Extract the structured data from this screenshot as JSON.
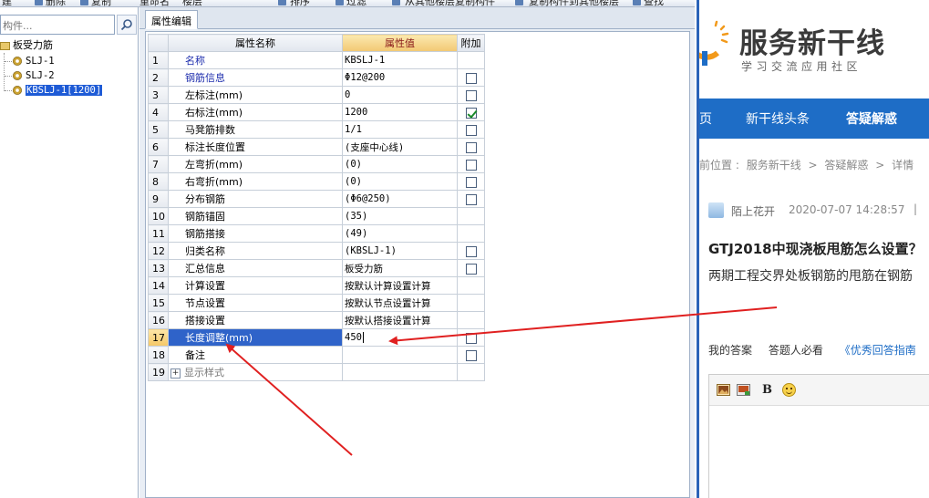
{
  "toolbar": {
    "items": [
      "建",
      "删除",
      "复制",
      "重命名",
      "楼层",
      "排序",
      "过滤",
      "从其他楼层复制构件",
      "复制构件到其他楼层",
      "查找"
    ]
  },
  "tree": {
    "search_placeholder": "构件...",
    "root_label": "板受力筋",
    "nodes": [
      {
        "label": "SLJ-1"
      },
      {
        "label": "SLJ-2"
      },
      {
        "label": "KBSLJ-1[1200]"
      }
    ]
  },
  "editor": {
    "tab_label": "属性编辑",
    "columns": {
      "name": "属性名称",
      "value": "属性值",
      "extra": "附加"
    },
    "rows": [
      {
        "idx": "1",
        "name": "名称",
        "value": "KBSLJ-1",
        "check": "none",
        "style": "blue"
      },
      {
        "idx": "2",
        "name": "钢筋信息",
        "value": "Φ12@200",
        "check": "unchecked",
        "style": "blue"
      },
      {
        "idx": "3",
        "name": "左标注(mm)",
        "value": "0",
        "check": "unchecked",
        "style": "black"
      },
      {
        "idx": "4",
        "name": "右标注(mm)",
        "value": "1200",
        "check": "checked",
        "style": "black"
      },
      {
        "idx": "5",
        "name": "马凳筋排数",
        "value": "1/1",
        "check": "unchecked",
        "style": "black"
      },
      {
        "idx": "6",
        "name": "标注长度位置",
        "value": "(支座中心线)",
        "check": "unchecked",
        "style": "black"
      },
      {
        "idx": "7",
        "name": "左弯折(mm)",
        "value": "(0)",
        "check": "unchecked",
        "style": "black"
      },
      {
        "idx": "8",
        "name": "右弯折(mm)",
        "value": "(0)",
        "check": "unchecked",
        "style": "black"
      },
      {
        "idx": "9",
        "name": "分布钢筋",
        "value": "(Φ6@250)",
        "check": "unchecked",
        "style": "black"
      },
      {
        "idx": "10",
        "name": "钢筋锚固",
        "value": "(35)",
        "check": "none",
        "style": "black"
      },
      {
        "idx": "11",
        "name": "钢筋搭接",
        "value": "(49)",
        "check": "none",
        "style": "black"
      },
      {
        "idx": "12",
        "name": "归类名称",
        "value": "(KBSLJ-1)",
        "check": "unchecked",
        "style": "black"
      },
      {
        "idx": "13",
        "name": "汇总信息",
        "value": "板受力筋",
        "check": "unchecked",
        "style": "black"
      },
      {
        "idx": "14",
        "name": "计算设置",
        "value": "按默认计算设置计算",
        "check": "none",
        "style": "black"
      },
      {
        "idx": "15",
        "name": "节点设置",
        "value": "按默认节点设置计算",
        "check": "none",
        "style": "black"
      },
      {
        "idx": "16",
        "name": "搭接设置",
        "value": "按默认搭接设置计算",
        "check": "none",
        "style": "black"
      },
      {
        "idx": "17",
        "name": "长度调整(mm)",
        "value": "450",
        "check": "unchecked",
        "style": "active"
      },
      {
        "idx": "18",
        "name": "备注",
        "value": "",
        "check": "unchecked",
        "style": "black"
      },
      {
        "idx": "19",
        "name": "显示样式",
        "value": "",
        "check": "none",
        "style": "gray",
        "expander": "+"
      }
    ]
  },
  "web": {
    "site_name": "服务新干线",
    "slogan": "学习交流应用社区",
    "nav": [
      "页",
      "新干线头条",
      "答疑解惑"
    ],
    "breadcrumb": [
      "前位置 :",
      "服务新干线",
      "答疑解惑",
      "详情"
    ],
    "breadcrumb_sep": ">",
    "author": "陌上花开",
    "post_time": "2020-07-07 14:28:57",
    "post_sep": "|",
    "question_title": "GTJ2018中现浇板甩筋怎么设置？",
    "question_desc": "两期工程交界处板钢筋的甩筋在钢筋",
    "answer_tabs": [
      "我的答案",
      "答题人必看",
      "《优秀回答指南"
    ],
    "editor_buttons": {
      "bold": "B"
    }
  },
  "colors": {
    "nav_bg": "#1e6dc6",
    "selection": "#2f63c9",
    "annotation_arrow": "#e02020",
    "value_header": "#f2c873"
  },
  "icons": {
    "tree_search": "magnifier-icon",
    "tree_root": "folder-icon",
    "tree_node": "gear-icon",
    "check": "checkmark-icon",
    "logo": "logo-mark-icon",
    "editor_image": "image-icon",
    "editor_image2": "picture-icon",
    "emoji": "smiley-icon"
  }
}
